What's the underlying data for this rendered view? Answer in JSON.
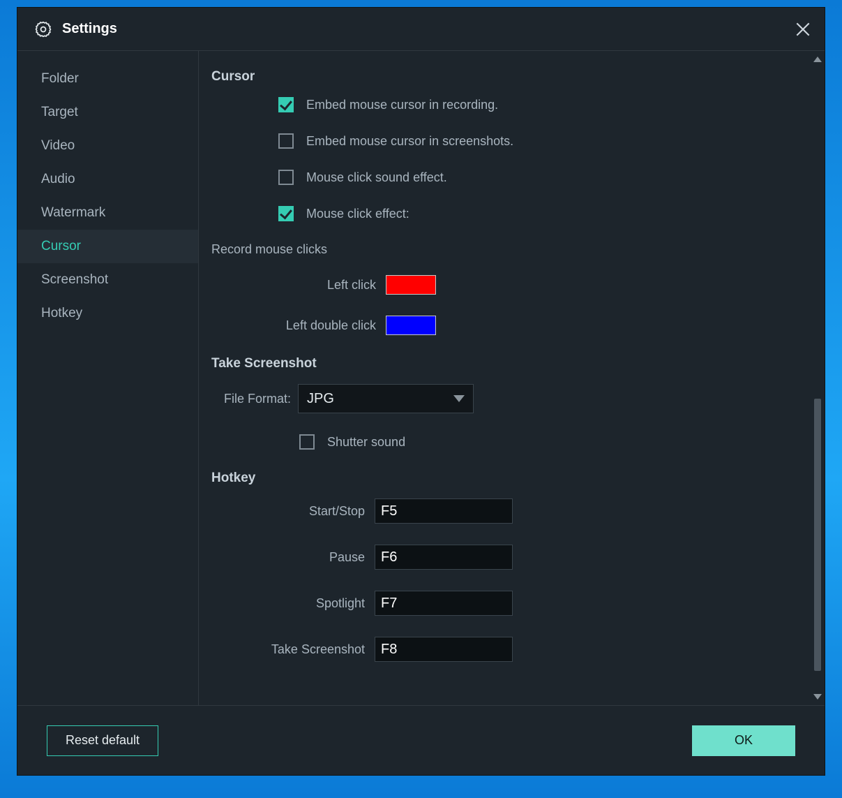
{
  "window": {
    "title": "Settings"
  },
  "sidebar": {
    "items": [
      {
        "label": "Folder",
        "active": false
      },
      {
        "label": "Target",
        "active": false
      },
      {
        "label": "Video",
        "active": false
      },
      {
        "label": "Audio",
        "active": false
      },
      {
        "label": "Watermark",
        "active": false
      },
      {
        "label": "Cursor",
        "active": true
      },
      {
        "label": "Screenshot",
        "active": false
      },
      {
        "label": "Hotkey",
        "active": false
      }
    ]
  },
  "cursor": {
    "title": "Cursor",
    "options": [
      {
        "label": "Embed mouse cursor in recording.",
        "checked": true
      },
      {
        "label": "Embed mouse cursor in screenshots.",
        "checked": false
      },
      {
        "label": "Mouse click sound effect.",
        "checked": false
      },
      {
        "label": "Mouse click effect:",
        "checked": true
      }
    ],
    "record_clicks_header": "Record mouse clicks",
    "left_click_label": "Left click",
    "left_click_color": "#ff0000",
    "left_double_click_label": "Left double click",
    "left_double_click_color": "#0000ff"
  },
  "screenshot": {
    "title": "Take Screenshot",
    "file_format_label": "File Format:",
    "file_format_value": "JPG",
    "shutter_sound_label": "Shutter sound",
    "shutter_sound_checked": false
  },
  "hotkey": {
    "title": "Hotkey",
    "rows": [
      {
        "label": "Start/Stop",
        "value": "F5"
      },
      {
        "label": "Pause",
        "value": "F6"
      },
      {
        "label": "Spotlight",
        "value": "F7"
      },
      {
        "label": "Take Screenshot",
        "value": "F8"
      }
    ]
  },
  "footer": {
    "reset_label": "Reset default",
    "ok_label": "OK"
  }
}
